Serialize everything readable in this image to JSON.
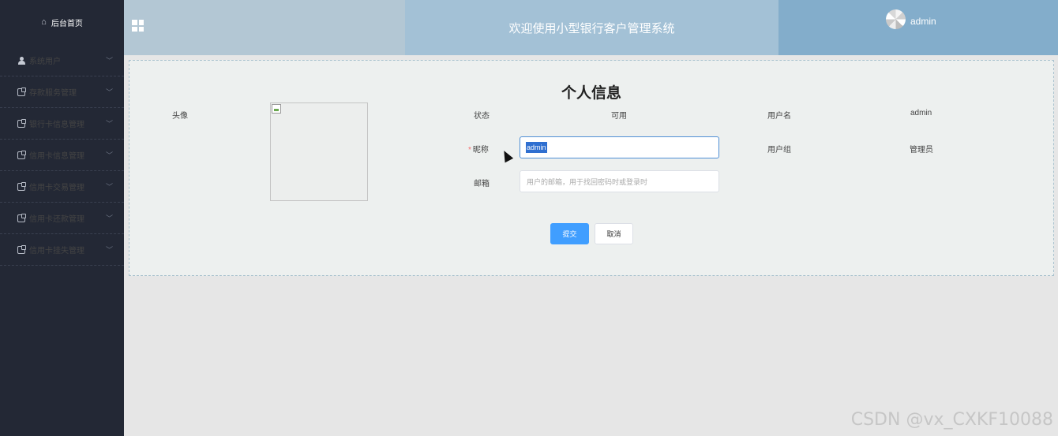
{
  "sidebar": {
    "home_label": "后台首页",
    "items": [
      {
        "label": "系统用户",
        "icon": "user-icon"
      },
      {
        "label": "存款服务管理",
        "icon": "document-icon"
      },
      {
        "label": "银行卡信息管理",
        "icon": "document-icon"
      },
      {
        "label": "信用卡信息管理",
        "icon": "document-icon"
      },
      {
        "label": "信用卡交易管理",
        "icon": "document-icon"
      },
      {
        "label": "信用卡还款管理",
        "icon": "document-icon"
      },
      {
        "label": "信用卡挂失管理",
        "icon": "document-icon"
      }
    ]
  },
  "header": {
    "title": "欢迎使用小型银行客户管理系统",
    "user": "admin"
  },
  "main": {
    "title": "个人信息",
    "avatar_label": "头像",
    "status_label": "状态",
    "status_value": "可用",
    "username_label": "用户名",
    "username_value": "admin",
    "nickname_label": "昵称",
    "nickname_value": "admin",
    "usergroup_label": "用户组",
    "usergroup_value": "管理员",
    "email_label": "邮箱",
    "email_placeholder": "用户的邮箱，用于找回密码时或登录时",
    "submit_label": "提交",
    "cancel_label": "取消"
  },
  "watermark": "CSDN @vx_CXKF10088",
  "colors": {
    "sidebar_bg": "#232835",
    "primary": "#409eff",
    "header_mid": "#a3c1d6",
    "header_right": "#83adcb"
  }
}
